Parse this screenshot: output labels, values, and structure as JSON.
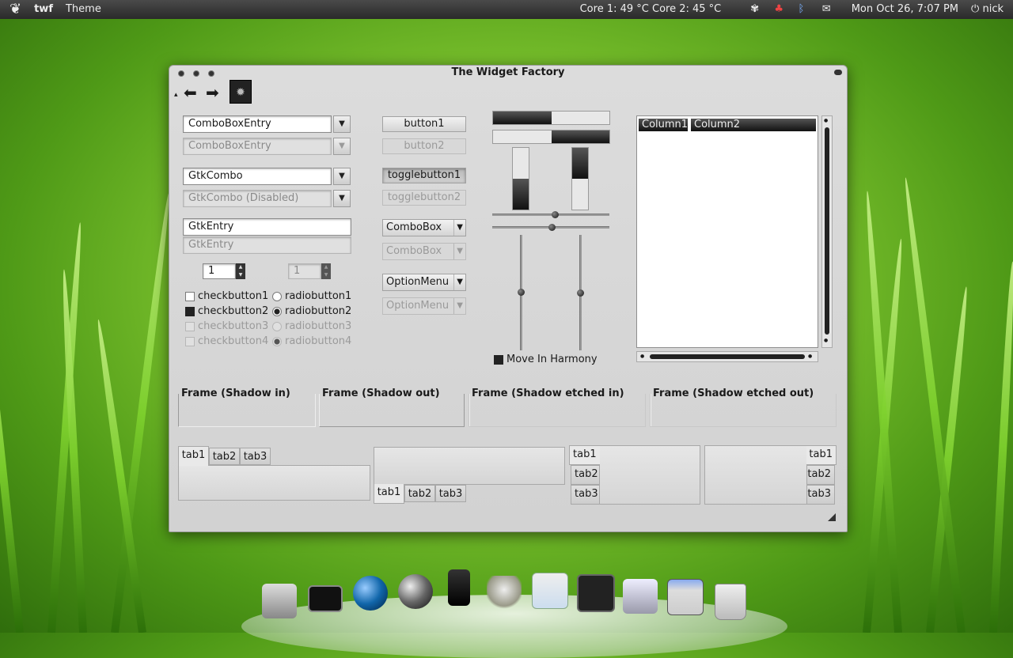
{
  "panel": {
    "app_name": "twf",
    "menu": "Theme",
    "sensors": "Core 1: 49 °C  Core 2: 45 °C",
    "datetime": "Mon Oct 26,  7:07 PM",
    "user": "nick",
    "tray_icons": [
      "foot-icon",
      "network-icon",
      "bluetooth-icon",
      "mail-icon"
    ]
  },
  "window": {
    "title": "The Widget Factory"
  },
  "col1": {
    "comboentry1": "ComboBoxEntry",
    "comboentry2": "ComboBoxEntry",
    "gtkcombo1": "GtkCombo",
    "gtkcombo2": "GtkCombo (Disabled)",
    "entry1": "GtkEntry",
    "entry2": "GtkEntry",
    "spin1": "1",
    "spin2": "1",
    "checks": [
      "checkbutton1",
      "checkbutton2",
      "checkbutton3",
      "checkbutton4"
    ],
    "radios": [
      "radiobutton1",
      "radiobutton2",
      "radiobutton3",
      "radiobutton4"
    ]
  },
  "col2": {
    "button1": "button1",
    "button2": "button2",
    "toggle1": "togglebutton1",
    "toggle2": "togglebutton2",
    "combobox1": "ComboBox",
    "combobox2": "ComboBox",
    "option1": "OptionMenu",
    "option2": "OptionMenu"
  },
  "col3": {
    "progress_h1": 0.5,
    "progress_h2": 0.5,
    "progress_v1": 0.5,
    "progress_v2": 0.5,
    "harmony_label": "Move In Harmony",
    "harmony_checked": true
  },
  "tree": {
    "columns": [
      "Column1",
      "Column2"
    ]
  },
  "frames": [
    "Frame (Shadow in)",
    "Frame (Shadow out)",
    "Frame (Shadow etched in)",
    "Frame (Shadow etched out)"
  ],
  "tabs": [
    "tab1",
    "tab2",
    "tab3"
  ],
  "dock": {
    "icons": [
      "home-folder-icon",
      "terminal-icon",
      "browser-icon",
      "media-player-icon",
      "phone-icon",
      "gimp-icon",
      "document-viewer-icon",
      "system-monitor-icon",
      "settings-icon",
      "window-icon",
      "trash-icon"
    ]
  }
}
